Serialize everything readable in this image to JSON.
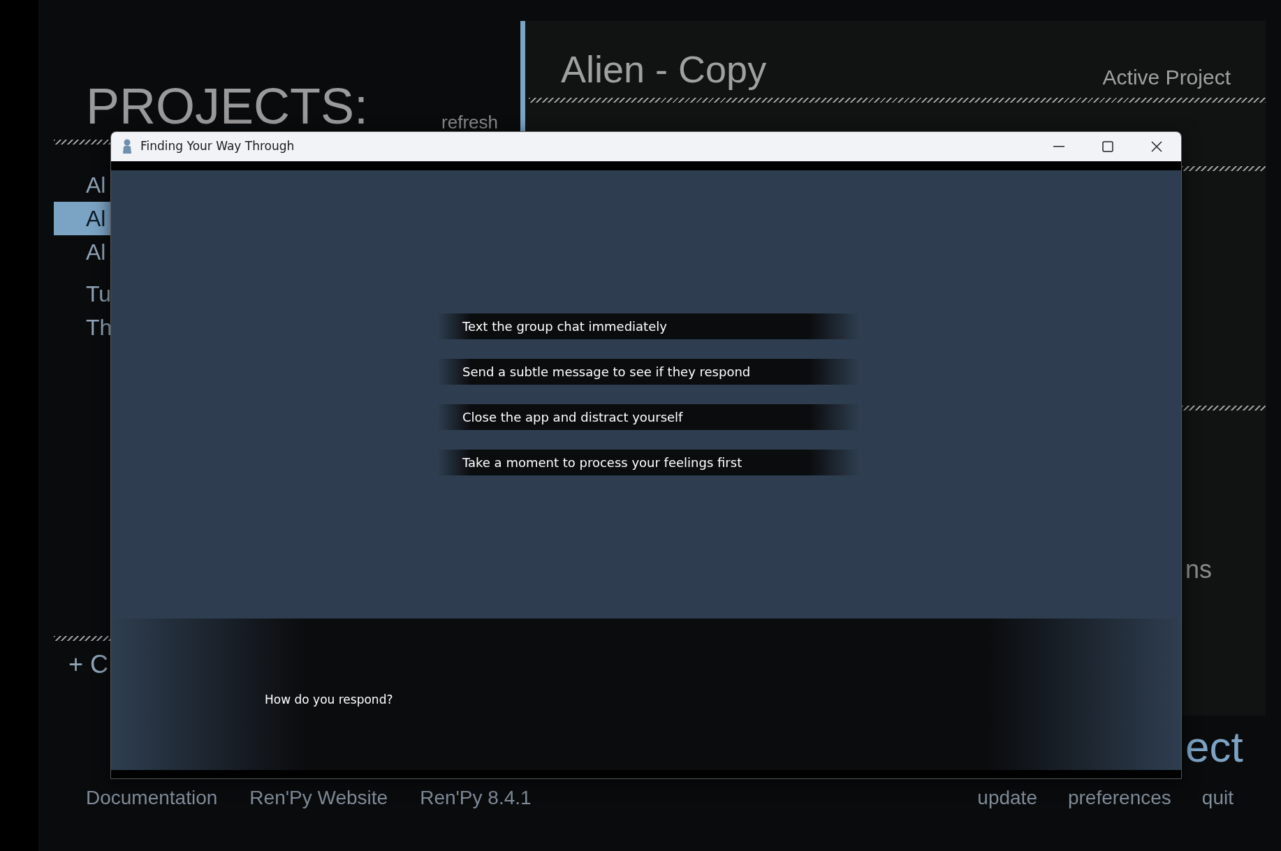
{
  "launcher": {
    "projects_heading": "PROJECTS:",
    "refresh": "refresh",
    "projects": [
      {
        "label": "Al",
        "selected": false
      },
      {
        "label": "Al",
        "selected": true
      },
      {
        "label": "Al",
        "selected": false
      }
    ],
    "tutorials": [
      {
        "label": "Tu",
        "selected": false
      },
      {
        "label": "Th",
        "selected": false
      }
    ],
    "create": "+ C",
    "active_project": {
      "name": "Alien - Copy",
      "label": "Active Project"
    },
    "panel_fragment": "ns",
    "launch_fragment": "ect",
    "footer_left": [
      "Documentation",
      "Ren'Py Website",
      "Ren'Py 8.4.1"
    ],
    "footer_right": [
      "update",
      "preferences",
      "quit"
    ]
  },
  "window": {
    "title": "Finding Your Way Through",
    "choices": [
      "Text the group chat immediately",
      "Send a subtle message to see if they respond",
      "Close the app and distract yourself",
      "Take a moment to process your feelings first"
    ],
    "dialogue": "How do you respond?"
  }
}
